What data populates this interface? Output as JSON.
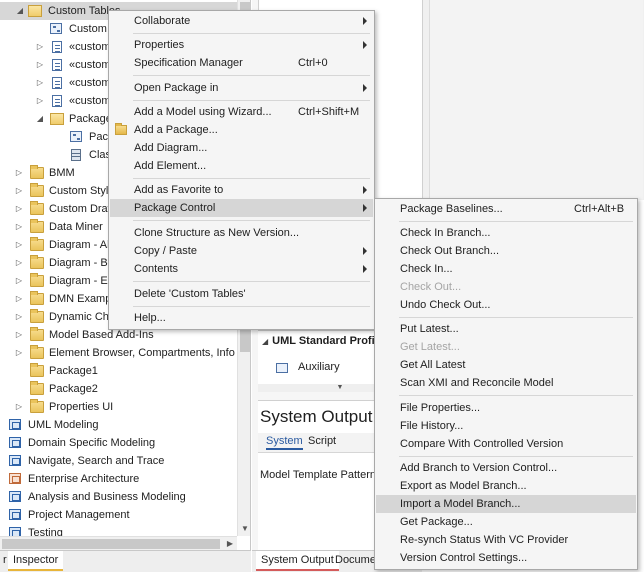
{
  "tree": {
    "rows": [
      {
        "label": "Custom Tables"
      },
      {
        "label": "Custom"
      },
      {
        "label": "«custom"
      },
      {
        "label": "«custom"
      },
      {
        "label": "«custom"
      },
      {
        "label": "«custom"
      },
      {
        "label": "Package"
      },
      {
        "label": "Pack"
      },
      {
        "label": "Clas"
      },
      {
        "label": "BMM"
      },
      {
        "label": "Custom Style"
      },
      {
        "label": "Custom Draw"
      },
      {
        "label": "Data Miner"
      },
      {
        "label": "Diagram - Al"
      },
      {
        "label": "Diagram - Ba"
      },
      {
        "label": "Diagram - El"
      },
      {
        "label": "DMN Examp"
      },
      {
        "label": "Dynamic Cha"
      },
      {
        "label": "Model Based Add-Ins"
      },
      {
        "label": "Element Browser, Compartments, Info V"
      },
      {
        "label": "Package1"
      },
      {
        "label": "Package2"
      },
      {
        "label": "Properties UI"
      },
      {
        "label": "UML Modeling"
      },
      {
        "label": "Domain Specific Modeling"
      },
      {
        "label": "Navigate, Search and Trace"
      },
      {
        "label": "Enterprise Architecture"
      },
      {
        "label": "Analysis and Business Modeling"
      },
      {
        "label": "Project Management"
      },
      {
        "label": "Testing"
      }
    ]
  },
  "bottom_tabs_left": {
    "partial": "r",
    "inspector": "Inspector"
  },
  "bottom_tabs_mid": {
    "system_output": "System Output",
    "document": "Documer"
  },
  "toolbox": {
    "header": "UML Standard Profile",
    "item": "Auxiliary"
  },
  "system_output": {
    "title": "System Output",
    "tab_system": "System",
    "tab_script": "Script",
    "message": "Model Template Pattern"
  },
  "menu1": {
    "collaborate": "Collaborate",
    "properties": "Properties",
    "spec_manager": "Specification Manager",
    "spec_manager_sc": "Ctrl+0",
    "open_package_in": "Open Package in",
    "add_model_wizard": "Add a Model using Wizard...",
    "add_model_wizard_sc": "Ctrl+Shift+M",
    "add_package": "Add a Package...",
    "add_diagram": "Add Diagram...",
    "add_element": "Add Element...",
    "add_favorite": "Add as Favorite to",
    "package_control": "Package Control",
    "clone_structure": "Clone Structure as New Version...",
    "copy_paste": "Copy / Paste",
    "contents": "Contents",
    "delete": "Delete 'Custom Tables'",
    "help": "Help..."
  },
  "menu2": {
    "baselines": "Package Baselines...",
    "baselines_sc": "Ctrl+Alt+B",
    "check_in_branch": "Check In Branch...",
    "check_out_branch": "Check Out Branch...",
    "check_in": "Check In...",
    "check_out": "Check Out...",
    "undo_check_out": "Undo Check Out...",
    "put_latest": "Put Latest...",
    "get_latest": "Get Latest...",
    "get_all_latest": "Get All Latest",
    "scan_xmi": "Scan XMI and Reconcile Model",
    "file_properties": "File Properties...",
    "file_history": "File History...",
    "compare": "Compare With Controlled Version",
    "add_branch": "Add Branch to Version Control...",
    "export_branch": "Export as Model Branch...",
    "import_branch": "Import a Model Branch...",
    "get_package": "Get Package...",
    "resynch": "Re-synch Status With VC Provider",
    "vc_settings": "Version Control Settings..."
  }
}
